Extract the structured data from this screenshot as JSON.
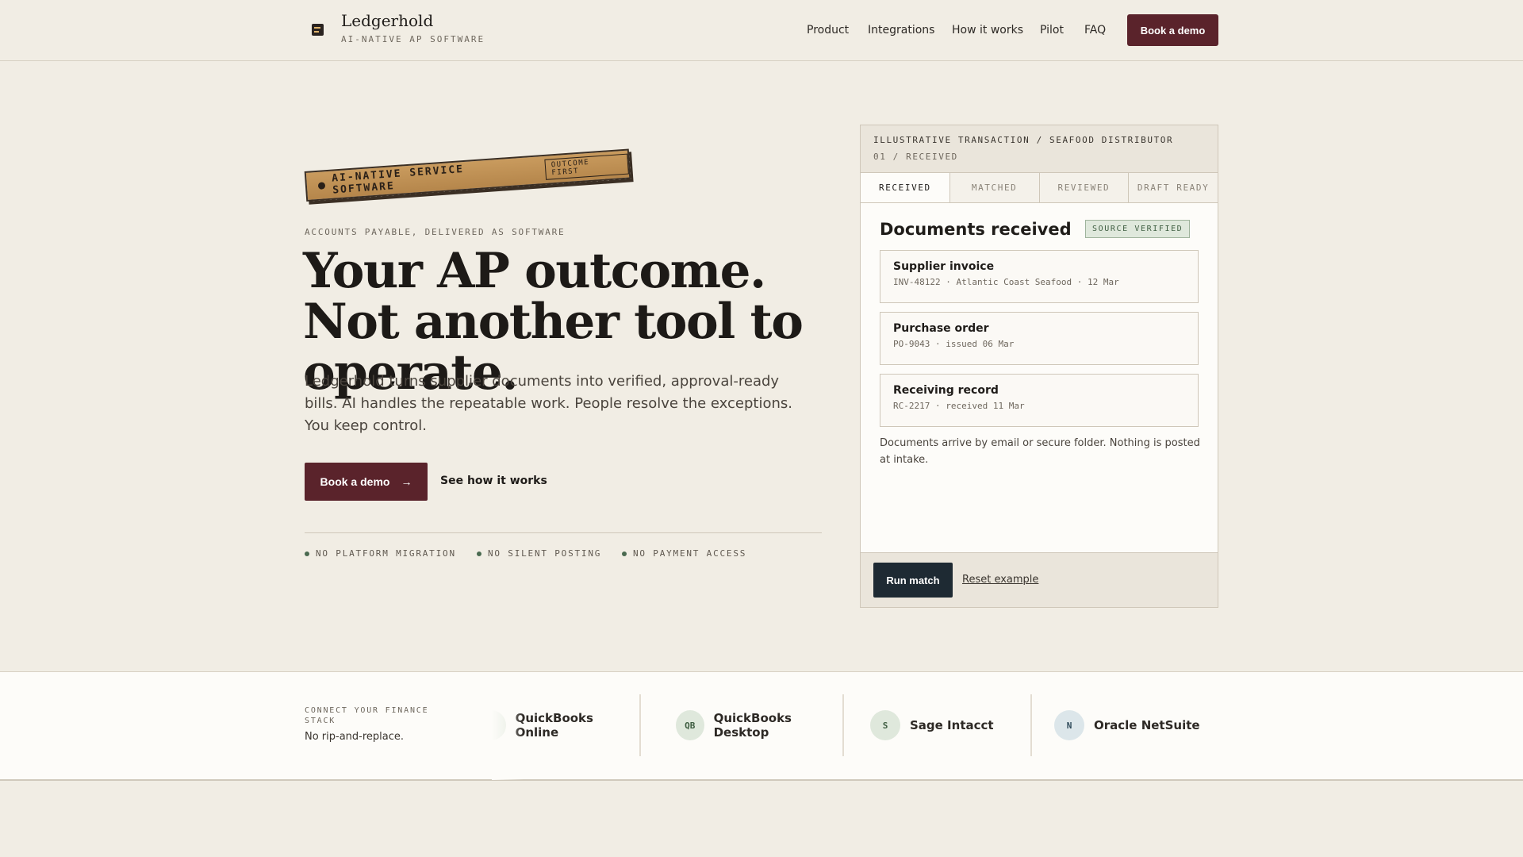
{
  "brand": {
    "name": "Ledgerhold",
    "tagline": "AI-NATIVE AP SOFTWARE"
  },
  "nav": {
    "items": [
      "Product",
      "Integrations",
      "How it works",
      "Pilot",
      "FAQ"
    ],
    "cta": "Book a demo"
  },
  "hero": {
    "stamp_text": "AI-NATIVE SERVICE SOFTWARE",
    "stamp_badge": "OUTCOME FIRST",
    "eyebrow": "ACCOUNTS PAYABLE, DELIVERED AS SOFTWARE",
    "headline": "Your AP outcome. Not another tool to operate.",
    "lede": "Ledgerhold turns supplier documents into verified, approval-ready bills. AI handles the repeatable work. People resolve the exceptions. You keep control.",
    "primary_cta": "Book a demo",
    "primary_cta_arrow": "→",
    "secondary_cta": "See how it works",
    "assurances": [
      "NO PLATFORM MIGRATION",
      "NO SILENT POSTING",
      "NO PAYMENT ACCESS"
    ]
  },
  "transaction": {
    "title": "ILLUSTRATIVE TRANSACTION / SEAFOOD DISTRIBUTOR",
    "step": "01 / RECEIVED",
    "tabs": [
      "RECEIVED",
      "MATCHED",
      "REVIEWED",
      "DRAFT READY"
    ],
    "active_tab": "RECEIVED",
    "panel_title": "Documents received",
    "status_badge": "SOURCE VERIFIED",
    "documents": [
      {
        "name": "Supplier invoice",
        "meta": "INV-48122 · Atlantic Coast Seafood · 12 Mar"
      },
      {
        "name": "Purchase order",
        "meta": "PO-9043 · issued 06 Mar"
      },
      {
        "name": "Receiving record",
        "meta": "RC-2217 · received 11 Mar"
      }
    ],
    "note": "Documents arrive by email or secure folder. Nothing is posted at intake.",
    "run_button": "Run match",
    "reset_link": "Reset example"
  },
  "integrations": {
    "label": "CONNECT YOUR FINANCE STACK",
    "sub": "No rip-and-replace.",
    "items": [
      {
        "badge": "",
        "name": "QuickBooks Online"
      },
      {
        "badge": "QB",
        "name": "QuickBooks Desktop"
      },
      {
        "badge": "S",
        "name": "Sage Intacct"
      },
      {
        "badge": "N",
        "name": "Oracle NetSuite"
      }
    ]
  },
  "colors": {
    "background": "#f1ede4",
    "accent": "#5a232b",
    "dark_button": "#1e2a33",
    "stamp": "#c99b5e",
    "verified_green": "#3f5e42"
  }
}
